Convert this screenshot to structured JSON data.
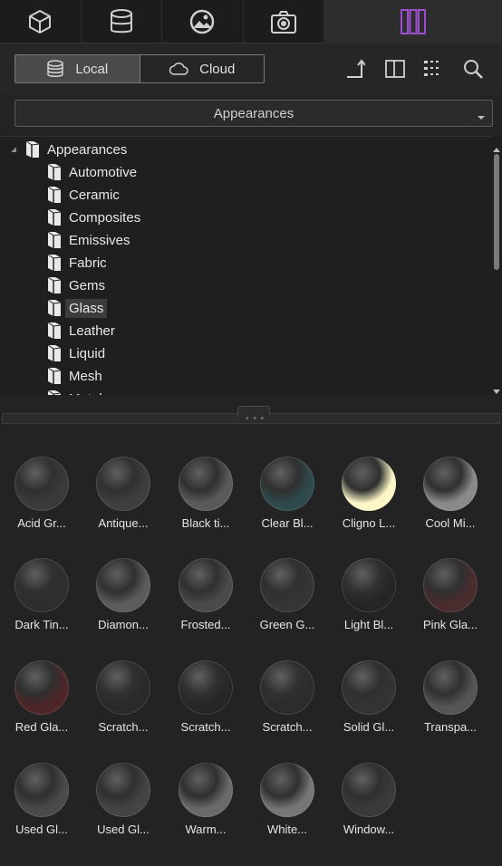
{
  "top_tabs": [
    {
      "icon": "cube-icon"
    },
    {
      "icon": "database-icon"
    },
    {
      "icon": "image-icon"
    },
    {
      "icon": "camera-icon"
    },
    {
      "icon": "library-icon",
      "active": true,
      "accent": "#9b4fd0"
    }
  ],
  "source_toggle": {
    "local_label": "Local",
    "cloud_label": "Cloud",
    "selected": "Local"
  },
  "toolbar_icons": [
    "export-icon",
    "panel-icon",
    "tree-view-icon",
    "search-icon"
  ],
  "dropdown": {
    "value": "Appearances"
  },
  "tree": {
    "root": "Appearances",
    "items": [
      "Automotive",
      "Ceramic",
      "Composites",
      "Emissives",
      "Fabric",
      "Gems",
      "Glass",
      "Leather",
      "Liquid",
      "Mesh",
      "Metal"
    ],
    "selected": "Glass"
  },
  "materials": [
    {
      "label": "Acid Gr...",
      "color": "#3a3a3a"
    },
    {
      "label": "Antique...",
      "color": "#3e3e3e"
    },
    {
      "label": "Black ti...",
      "color": "#5a5a5a"
    },
    {
      "label": "Clear Bl...",
      "color": "#2e4a4c"
    },
    {
      "label": "Cligno L...",
      "color": "#fdf7c8"
    },
    {
      "label": "Cool Mi...",
      "color": "#8a8a8a"
    },
    {
      "label": "Dark Tin...",
      "color": "#2e2e2e"
    },
    {
      "label": "Diamon...",
      "color": "#5c5c5c"
    },
    {
      "label": "Frosted...",
      "color": "#4a4a4a"
    },
    {
      "label": "Green G...",
      "color": "#333633"
    },
    {
      "label": "Light Bl...",
      "color": "#252525"
    },
    {
      "label": "Pink Gla...",
      "color": "#4a2c2e"
    },
    {
      "label": "Red Gla...",
      "color": "#4e2528"
    },
    {
      "label": "Scratch...",
      "color": "#2a2a2a"
    },
    {
      "label": "Scratch...",
      "color": "#262626"
    },
    {
      "label": "Scratch...",
      "color": "#2c2c2c"
    },
    {
      "label": "Solid Gl...",
      "color": "#333333"
    },
    {
      "label": "Transpa...",
      "color": "#555555"
    },
    {
      "label": "Used Gl...",
      "color": "#4a4a4a"
    },
    {
      "label": "Used Gl...",
      "color": "#444444"
    },
    {
      "label": "Warm...",
      "color": "#6a6a6a"
    },
    {
      "label": "White...",
      "color": "#767676"
    },
    {
      "label": "Window...",
      "color": "#3a3a3a"
    }
  ]
}
